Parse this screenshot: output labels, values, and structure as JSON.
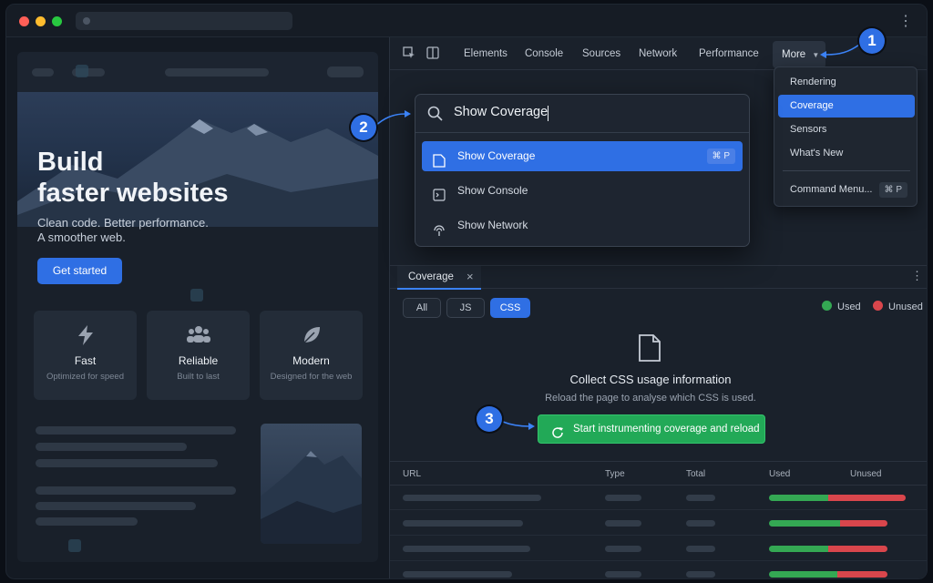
{
  "page": {
    "hero_title_line1": "Build",
    "hero_title_line2": "faster websites",
    "hero_sub_line1": "Clean code. Better performance.",
    "hero_sub_line2": "A smoother web.",
    "cta_label": "Get started",
    "features": [
      {
        "icon": "lightning-icon",
        "title": "Fast",
        "subtitle": "Optimized for speed"
      },
      {
        "icon": "users-icon",
        "title": "Reliable",
        "subtitle": "Built to last"
      },
      {
        "icon": "leaf-icon",
        "title": "Modern",
        "subtitle": "Designed for the web"
      }
    ]
  },
  "devtools": {
    "tabs": [
      "Elements",
      "Console",
      "Sources",
      "Network",
      "Performance"
    ],
    "more_label": "More",
    "more_menu": {
      "items": [
        "Rendering",
        "Coverage",
        "Sensors",
        "What's New"
      ],
      "selected": "Coverage",
      "command_menu_label": "Command Menu...",
      "command_menu_shortcut": "⌘ P"
    },
    "palette": {
      "query": "Show Coverage",
      "items": [
        {
          "label": "Show Coverage",
          "icon": "file-icon",
          "shortcut": "⌘ P",
          "selected": true
        },
        {
          "label": "Show Console",
          "icon": "terminal-icon",
          "shortcut": "",
          "selected": false
        },
        {
          "label": "Show Network",
          "icon": "network-icon",
          "shortcut": "",
          "selected": false
        }
      ]
    },
    "coverage": {
      "tab_label": "Coverage",
      "filters": [
        "All",
        "JS",
        "CSS"
      ],
      "selected_filter": "CSS",
      "legend_used": "Used",
      "legend_unused": "Unused",
      "empty_title": "Collect CSS usage information",
      "empty_subtitle": "Reload the page to analyse which CSS is used.",
      "start_button": "Start instrumenting coverage and reload",
      "columns": [
        "URL",
        "Type",
        "Total",
        "Used",
        "Unused"
      ],
      "rows": [
        {
          "used_fraction": 0.43
        },
        {
          "used_fraction": 0.6
        },
        {
          "used_fraction": 0.5
        },
        {
          "used_fraction": 0.58
        }
      ]
    },
    "colors": {
      "accent": "#2f6fe4",
      "used": "#34a853",
      "unused": "#d9464c",
      "start": "#22a957"
    }
  },
  "steps": [
    "1",
    "2",
    "3"
  ]
}
